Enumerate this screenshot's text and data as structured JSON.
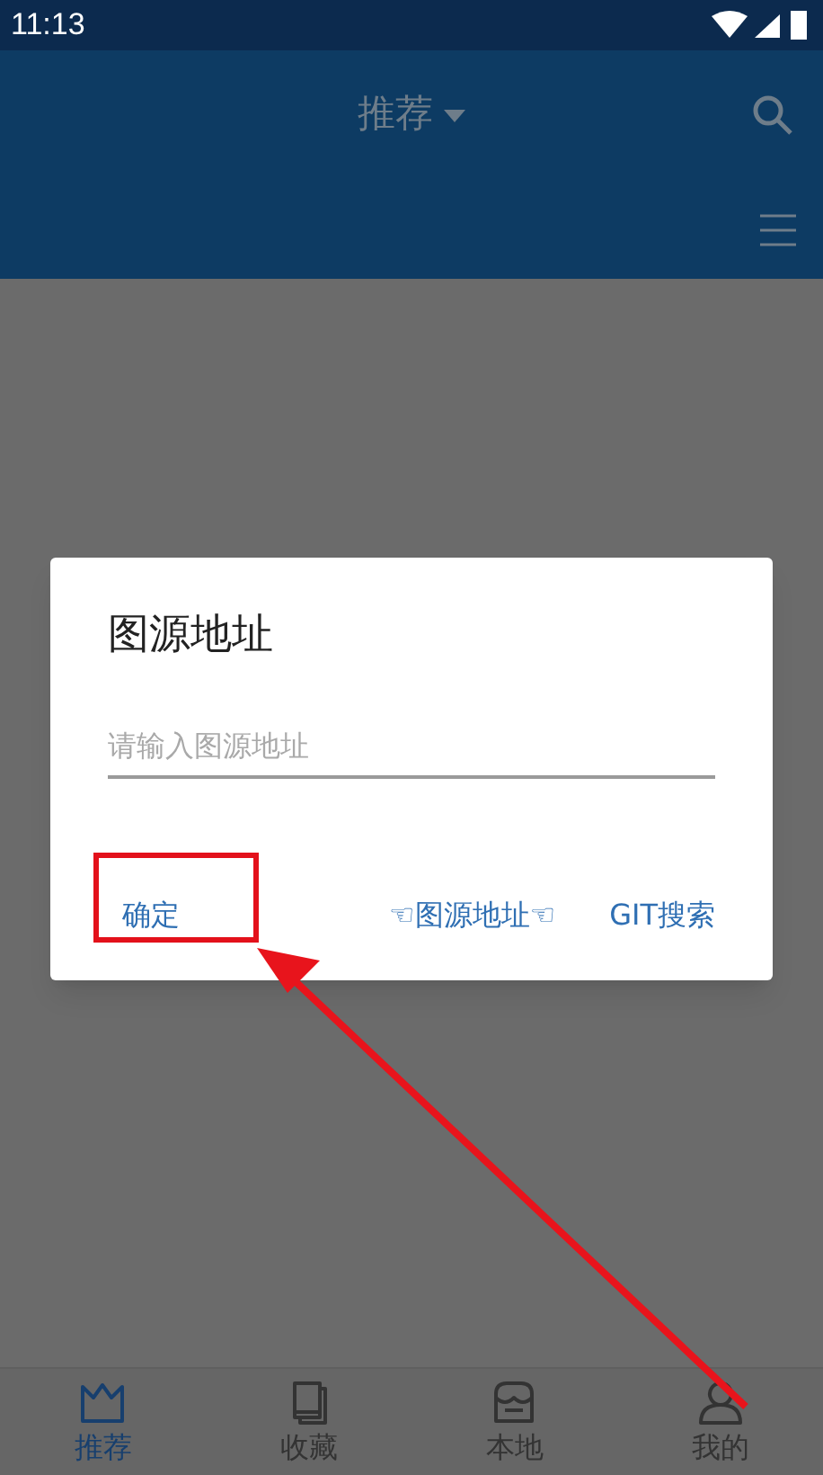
{
  "status_bar": {
    "time": "11:13"
  },
  "app_bar": {
    "title": "推荐"
  },
  "dialog": {
    "title": "图源地址",
    "field": {
      "placeholder": "请输入图源地址"
    },
    "buttons": [
      "确定",
      "☜图源地址☜",
      "GIT搜索"
    ]
  },
  "bottom_nav": [
    {
      "label": "推荐",
      "kind": "crown",
      "selected": true
    },
    {
      "label": "收藏",
      "kind": "book",
      "selected": false
    },
    {
      "label": "本地",
      "kind": "store",
      "selected": false
    },
    {
      "label": "我的",
      "kind": "person",
      "selected": false
    }
  ]
}
